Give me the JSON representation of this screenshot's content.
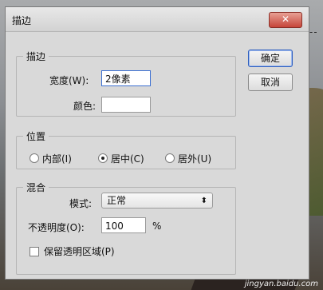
{
  "dialog": {
    "title": "描边",
    "close_icon": "close-icon"
  },
  "stroke": {
    "legend": "描边",
    "width_label": "宽度(W):",
    "width_value": "2",
    "width_unit": "像素",
    "color_label": "颜色:"
  },
  "position": {
    "legend": "位置",
    "options": [
      {
        "label": "内部(I)",
        "checked": false
      },
      {
        "label": "居中(C)",
        "checked": true
      },
      {
        "label": "居外(U)",
        "checked": false
      }
    ]
  },
  "blend": {
    "legend": "混合",
    "mode_label": "模式:",
    "mode_value": "正常",
    "opacity_label": "不透明度(O):",
    "opacity_value": "100",
    "opacity_unit": "%",
    "preserve_label": "保留透明区域(P)"
  },
  "buttons": {
    "ok": "确定",
    "cancel": "取消"
  },
  "watermark": "jingyan.baidu.com"
}
